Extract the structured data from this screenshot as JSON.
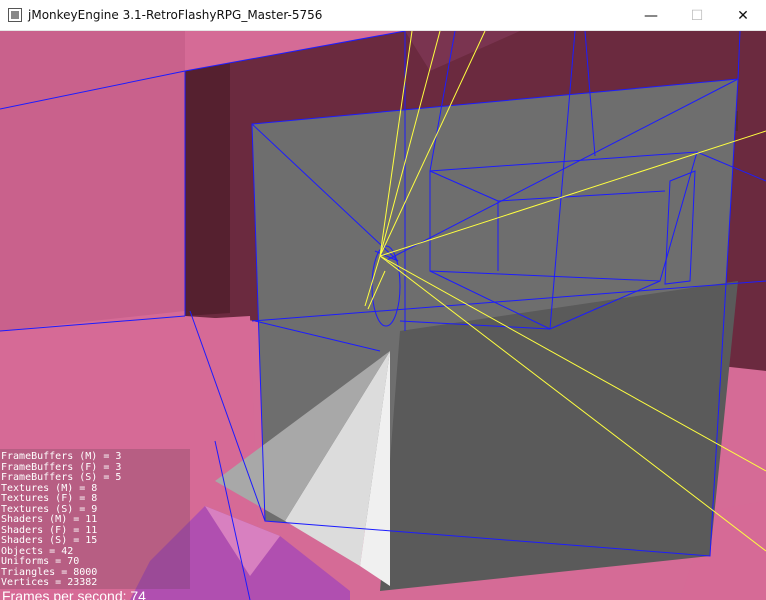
{
  "window": {
    "title": "jMonkeyEngine 3.1-RetroFlashyRPG_Master-5756",
    "icon": "app-icon",
    "controls": {
      "minimize": "—",
      "maximize": "☐",
      "close": "✕"
    }
  },
  "stats": [
    "FrameBuffers (M) = 3",
    "FrameBuffers (F) = 3",
    "FrameBuffers (S) = 5",
    "Textures (M) = 8",
    "Textures (F) = 8",
    "Textures (S) = 9",
    "Shaders (M) = 11",
    "Shaders (F) = 11",
    "Shaders (S) = 15",
    "Objects = 42",
    "Uniforms = 70",
    "Triangles = 8000",
    "Vertices = 23382"
  ],
  "fps_text": "Frames per second: 74",
  "colors": {
    "wall_pink": "#d56b96",
    "wall_maroon": "#6b2a3f",
    "wireframe": "#1c1cff",
    "light_rays": "#ffff40",
    "panel_gray": "#6e6e6e"
  }
}
